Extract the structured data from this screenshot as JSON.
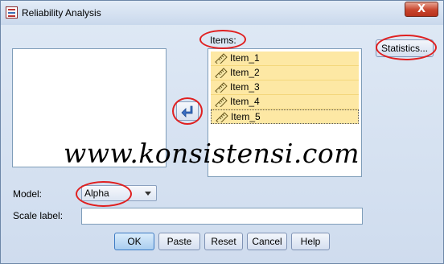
{
  "window": {
    "title": "Reliability Analysis",
    "close_symbol": "X"
  },
  "items": {
    "label": "Items:",
    "list": [
      {
        "label": "Item_1"
      },
      {
        "label": "Item_2"
      },
      {
        "label": "Item_3"
      },
      {
        "label": "Item_4"
      },
      {
        "label": "Item_5"
      }
    ]
  },
  "buttons": {
    "statistics": "Statistics...",
    "ok": "OK",
    "paste": "Paste",
    "reset": "Reset",
    "cancel": "Cancel",
    "help": "Help"
  },
  "model": {
    "label": "Model:",
    "value": "Alpha"
  },
  "scale_label": {
    "label": "Scale label:",
    "value": ""
  },
  "watermark": "www.konsistensi.com",
  "icons": [
    "app-icon",
    "close-icon",
    "ruler-icon",
    "move-arrow-icon",
    "chevron-down-icon"
  ],
  "colors": {
    "selection": "#fde8a4",
    "annotation_ovals": "#e02020"
  }
}
